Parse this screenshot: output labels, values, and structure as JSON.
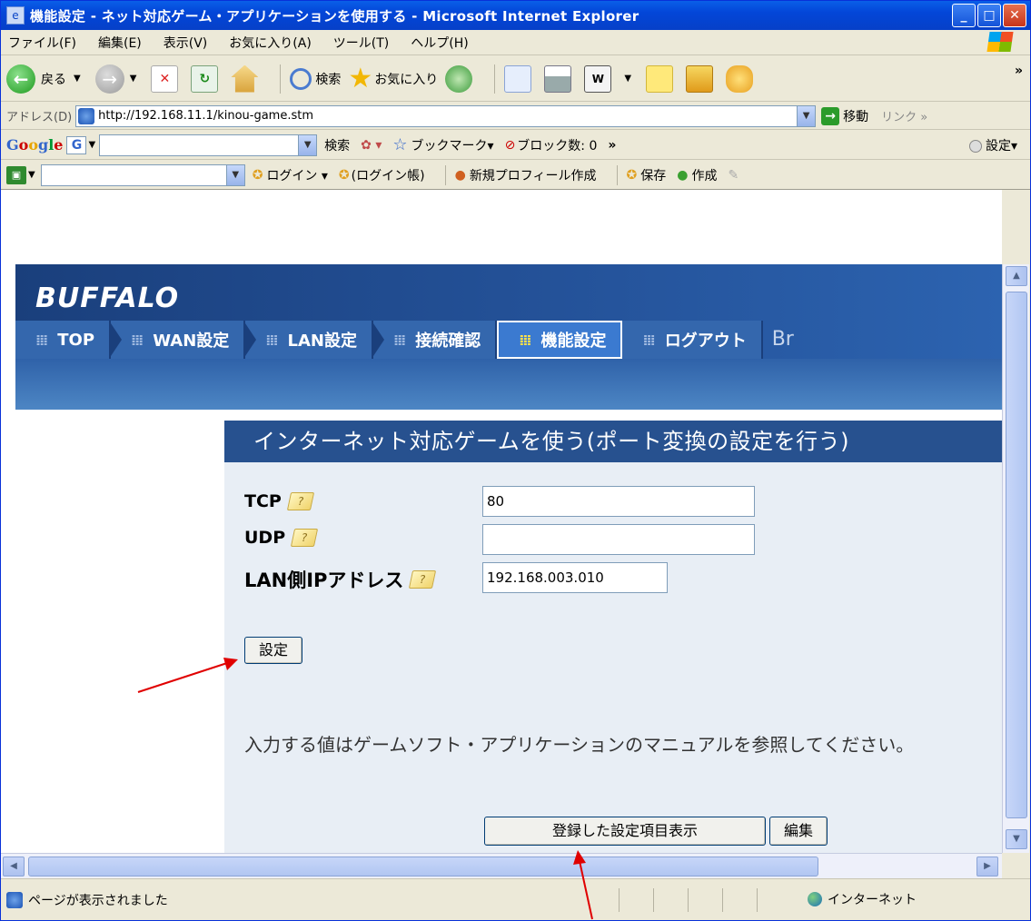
{
  "window": {
    "title": "機能設定 - ネット対応ゲーム・アプリケーションを使用する - Microsoft Internet Explorer"
  },
  "menu": [
    "ファイル(F)",
    "編集(E)",
    "表示(V)",
    "お気に入り(A)",
    "ツール(T)",
    "ヘルプ(H)"
  ],
  "toolbar": {
    "back_label": "戻る",
    "search_label": "検索",
    "favorites_label": "お気に入り",
    "overflow": "»"
  },
  "address": {
    "label": "アドレス(D)",
    "url": "http://192.168.11.1/kinou-game.stm",
    "go_label": "移動",
    "links_label": "リンク »"
  },
  "google_bar": {
    "search_label": "検索",
    "bookmarks_label": "ブックマーク▾",
    "block_count_label": "ブロック数: 0",
    "settings_label": "設定▾"
  },
  "bar4": {
    "login_label": "ログイン ▾",
    "login_book_label": "(ログイン帳)",
    "new_profile_label": "新規プロフィール作成",
    "save_label": "保存",
    "create_label": "作成"
  },
  "page": {
    "brand": "BUFFALO",
    "nav": [
      {
        "label": "TOP"
      },
      {
        "label": "WAN設定"
      },
      {
        "label": "LAN設定"
      },
      {
        "label": "接続確認"
      },
      {
        "label": "機能設定"
      },
      {
        "label": "ログアウト"
      }
    ],
    "nav_extra": "Br",
    "section_title": "インターネット対応ゲームを使う(ポート変換の設定を行う)",
    "form": {
      "tcp_label": "TCP",
      "tcp_value": "80",
      "udp_label": "UDP",
      "udp_value": "",
      "lanip_label": "LAN側IPアドレス",
      "lanip_value": "192.168.003.010",
      "set_button": "設定"
    },
    "note": "入力する値はゲームソフト・アプリケーションのマニュアルを参照してください。",
    "show_registered_button": "登録した設定項目表示",
    "edit_button": "編集"
  },
  "status": {
    "text": "ページが表示されました",
    "zone": "インターネット"
  },
  "colors": {
    "title_bar": "#0346d8",
    "banner": "#245299",
    "panel_title": "#27518f",
    "panel_bg": "#e8eef5",
    "annotation": "#e00000"
  }
}
